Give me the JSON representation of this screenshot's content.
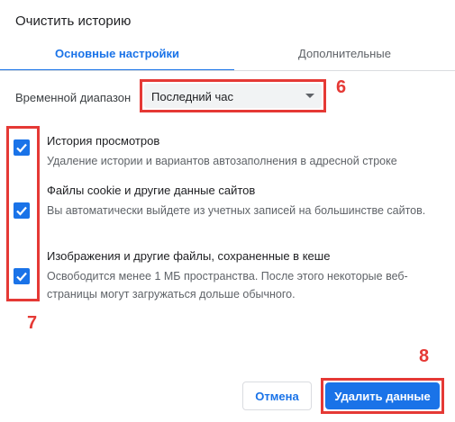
{
  "dialog": {
    "title": "Очистить историю"
  },
  "tabs": [
    {
      "label": "Основные настройки",
      "active": true
    },
    {
      "label": "Дополнительные",
      "active": false
    }
  ],
  "time_range": {
    "label": "Временной диапазон",
    "selected": "Последний час"
  },
  "items": [
    {
      "title": "История просмотров",
      "description": "Удаление истории и вариантов автозаполнения в адресной строке",
      "checked": true
    },
    {
      "title": "Файлы cookie и другие данные сайтов",
      "description": "Вы автоматически выйдете из учетных записей на большинстве сайтов.",
      "checked": true
    },
    {
      "title": "Изображения и другие файлы, сохраненные в кеше",
      "description": "Освободится менее 1 МБ пространства. После этого некоторые веб-страницы могут загружаться дольше обычного.",
      "checked": true
    }
  ],
  "buttons": {
    "cancel": "Отмена",
    "delete": "Удалить данные"
  },
  "annotations": {
    "select": "6",
    "checkboxes": "7",
    "delete_button": "8"
  },
  "colors": {
    "accent": "#1a73e8",
    "annotation": "#e53935"
  }
}
